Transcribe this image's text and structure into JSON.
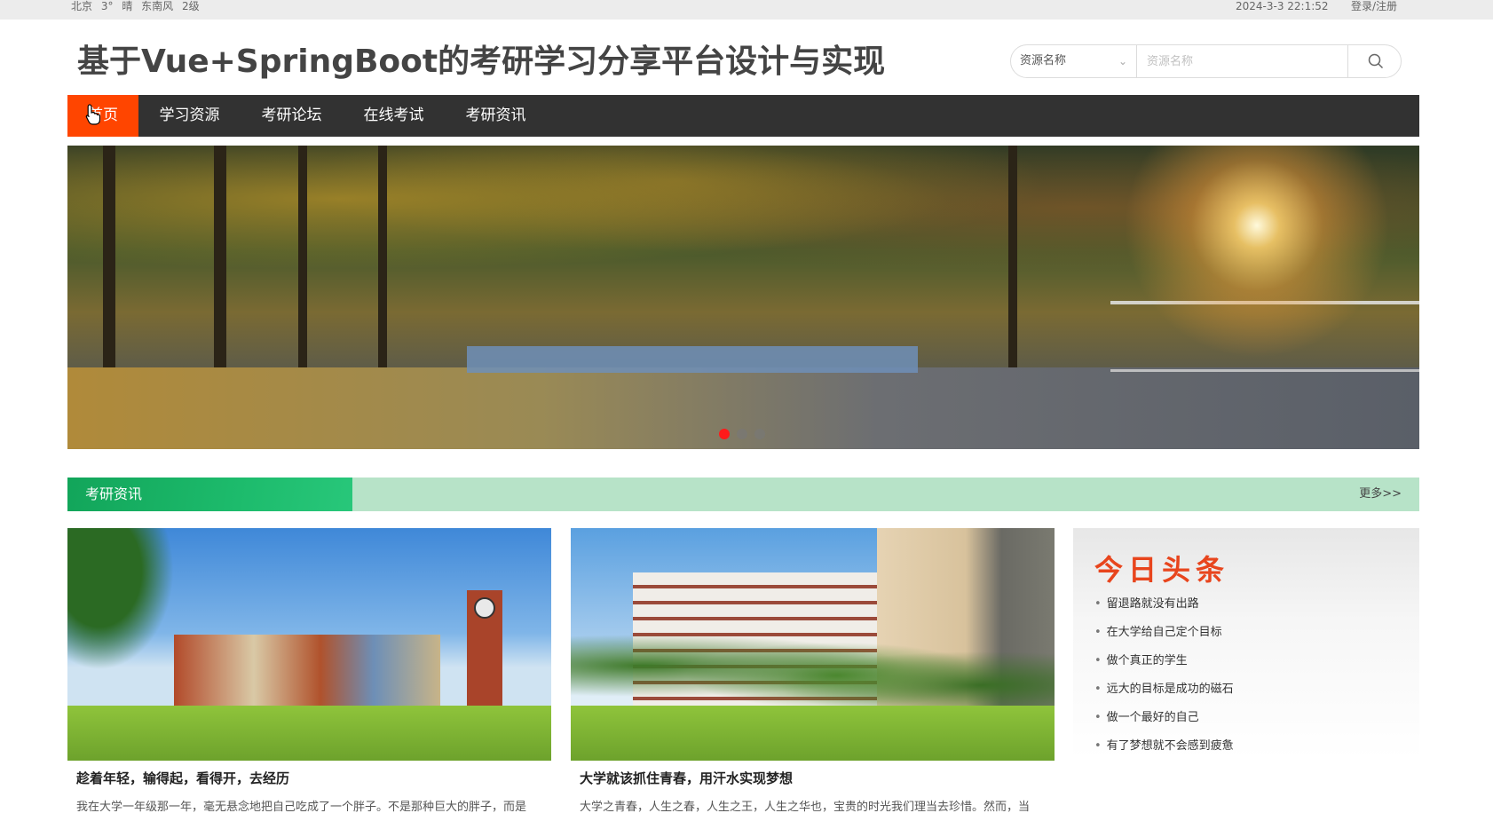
{
  "topbar": {
    "weather": {
      "city": "北京",
      "temp": "3°",
      "condition": "晴",
      "wind": "东南风",
      "level": "2级"
    },
    "datetime": "2024-3-3 22:1:52",
    "login_label": "登录/注册"
  },
  "header": {
    "title": "基于Vue+SpringBoot的考研学习分享平台设计与实现"
  },
  "search": {
    "category_selected": "资源名称",
    "placeholder": "资源名称",
    "value": "",
    "icon": "search-icon"
  },
  "nav": {
    "items": [
      {
        "label": "首页",
        "active": true
      },
      {
        "label": "学习资源",
        "active": false
      },
      {
        "label": "考研论坛",
        "active": false
      },
      {
        "label": "在线考试",
        "active": false
      },
      {
        "label": "考研资讯",
        "active": false
      }
    ],
    "active_color": "#ff4500",
    "bg_color": "#323232"
  },
  "banner": {
    "slide_count": 3,
    "active_slide": 1
  },
  "section": {
    "title": "考研资讯",
    "more_label": "更多>>",
    "accent": "#1dbb6c"
  },
  "news": [
    {
      "title": "趁着年轻，输得起，看得开，去经历",
      "excerpt": "我在大学一年级那一年，毫无悬念地把自己吃成了一个胖子。不是那种巨大的胖子，而是"
    },
    {
      "title": "大学就该抓住青春，用汗水实现梦想",
      "excerpt": "大学之青春，人生之春，人生之王，人生之华也，宝贵的时光我们理当去珍惜。然而，当"
    }
  ],
  "headlines": {
    "heading": "今日头条",
    "items": [
      "留退路就没有出路",
      "在大学给自己定个目标",
      "做个真正的学生",
      "远大的目标是成功的磁石",
      "做一个最好的自己",
      "有了梦想就不会感到疲惫"
    ]
  }
}
